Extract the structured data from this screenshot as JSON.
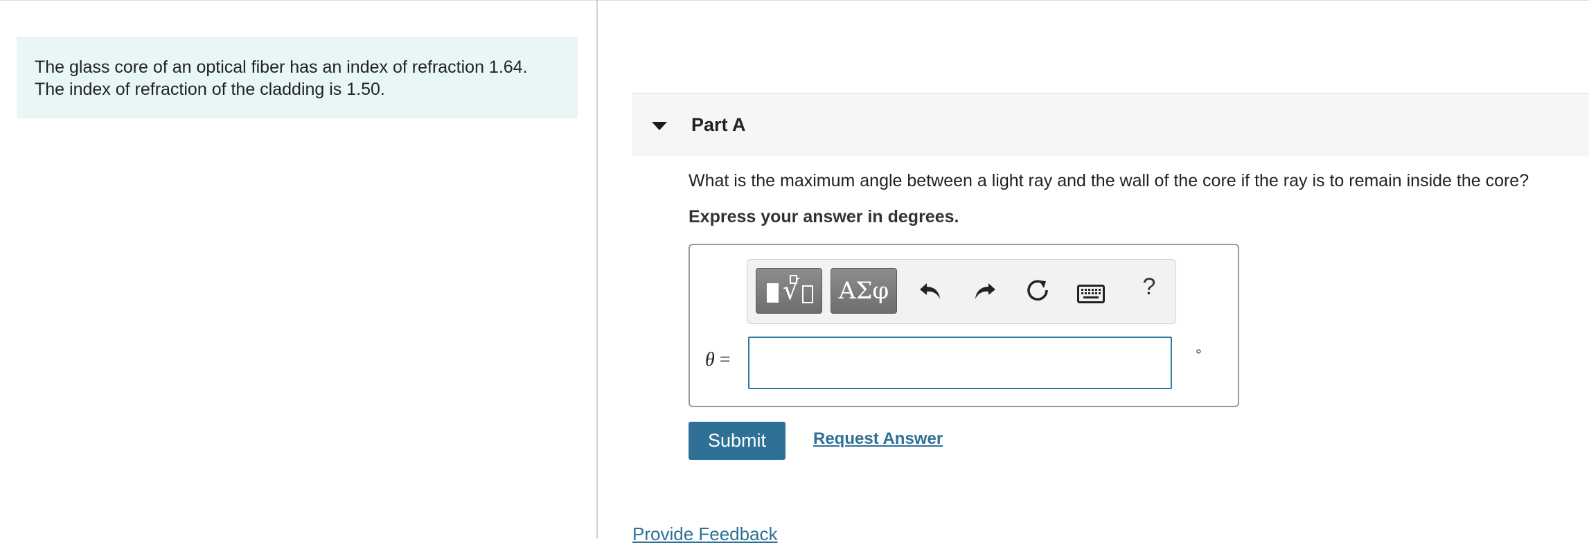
{
  "intro": {
    "line1": "The glass core of an optical fiber has an index of refraction 1.64.",
    "line2": "The index of refraction of the cladding is 1.50."
  },
  "part": {
    "title": "Part A",
    "question": "What is the maximum angle between a light ray and the wall of the core if the ray is to remain inside the core?",
    "instruction": "Express your answer in degrees."
  },
  "toolbar": {
    "greek_label": "ΑΣφ",
    "help_label": "?",
    "icons": [
      "templates-icon",
      "greek-symbols-icon",
      "undo-icon",
      "redo-icon",
      "reset-icon",
      "keyboard-icon",
      "help-icon"
    ]
  },
  "answer": {
    "variable": "θ",
    "equals": "=",
    "value": "",
    "unit": "°"
  },
  "actions": {
    "submit_label": "Submit",
    "request_answer_label": "Request Answer",
    "feedback_label": "Provide Feedback"
  },
  "colors": {
    "intro_bg": "#e8f6f5",
    "accent": "#2e7096",
    "input_border": "#2c7ba0"
  }
}
